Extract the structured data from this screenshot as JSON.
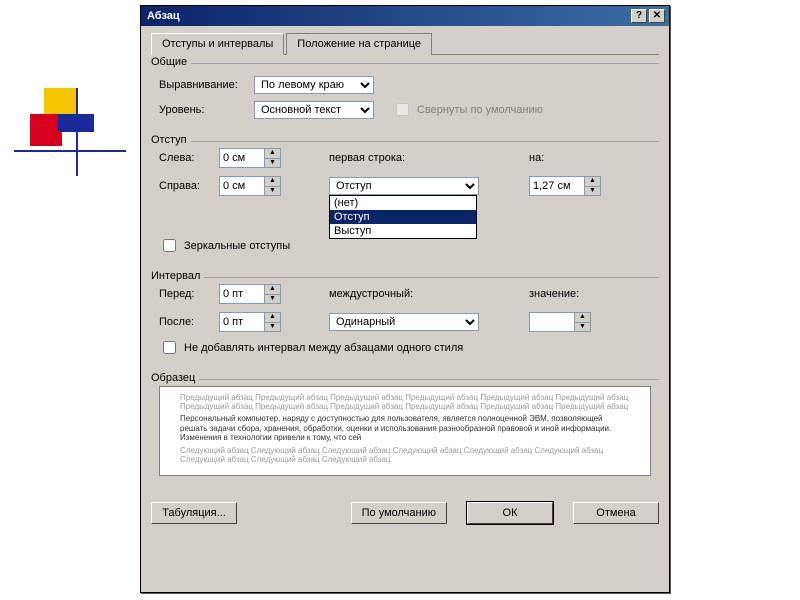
{
  "dialog": {
    "title": "Абзац"
  },
  "tabs": {
    "indents": "Отступы и интервалы",
    "position": "Положение на странице"
  },
  "groups": {
    "general": "Общие",
    "indent": "Отступ",
    "spacing": "Интервал",
    "sample": "Образец"
  },
  "general": {
    "align_label": "Выравнивание:",
    "align_value": "По левому краю",
    "level_label": "Уровень:",
    "level_value": "Основной текст",
    "collapsed_label": "Свернуты по умолчанию"
  },
  "indent": {
    "left_label": "Слева:",
    "left_value": "0 см",
    "right_label": "Справа:",
    "right_value": "0 см",
    "first_label": "первая строка:",
    "first_value": "Отступ",
    "by_label": "на:",
    "by_value": "1,27 см",
    "mirror_label": "Зеркальные отступы",
    "options": {
      "none": "(нет)",
      "indent": "Отступ",
      "hang": "Выступ"
    }
  },
  "spacing": {
    "before_label": "Перед:",
    "before_value": "0 пт",
    "after_label": "После:",
    "after_value": "0 пт",
    "line_label": "междустрочный:",
    "line_value": "Одинарный",
    "at_label": "значение:",
    "at_value": "",
    "noadd_label": "Не добавлять интервал между абзацами одного стиля"
  },
  "preview": {
    "prev_text": "Предыдущий абзац Предыдущий абзац Предыдущий абзац Предыдущий абзац Предыдущий абзац Предыдущий абзац Предыдущий абзац Предыдущий абзац Предыдущий абзац Предыдущий абзац Предыдущий абзац Предыдущий абзац",
    "body_text": "Персональный компьютер, наряду с доступностью для пользователя, является полноценной ЭВМ, позволяющей решать задачи сбора, хранения, обработки, оценки и использования разнообразной правовой и иной информации. Изменения в технологии привели к тому, что сей",
    "next_text": "Следующий абзац Следующий абзац Следующий абзац Следующий абзац Следующий абзац Следующий абзац Следующий абзац Следующий абзац Следующий абзац"
  },
  "buttons": {
    "tabs": "Табуляция...",
    "default": "По умолчанию",
    "ok": "ОК",
    "cancel": "Отмена"
  },
  "titlebar_icons": {
    "help": "?",
    "close": "✕"
  }
}
